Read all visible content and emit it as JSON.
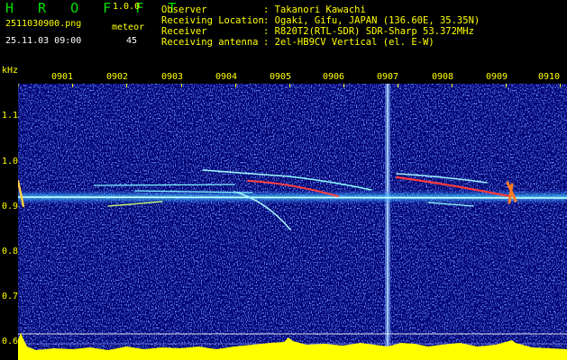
{
  "header": {
    "app_title": "H R O F F T",
    "version": "1.0.0",
    "file_name": "2511030900.png",
    "meteor_label": "meteor",
    "datetime": "25.11.03 09:00",
    "meteor_count": "45"
  },
  "station": [
    {
      "label": "Observer",
      "value": ": Takanori Kawachi"
    },
    {
      "label": "Receiving Location",
      "value": ": Ogaki, Gifu, JAPAN (136.60E, 35.35N)"
    },
    {
      "label": "Receiver",
      "value": ": R820T2(RTL-SDR) SDR-Sharp 53.372MHz"
    },
    {
      "label": "Receiving antenna",
      "value": ": 2el-HB9CV Vertical (el. E-W)"
    }
  ],
  "chart_data": {
    "type": "heatmap",
    "ylabel": "kHz",
    "x_ticks": [
      "0901",
      "0902",
      "0903",
      "0904",
      "0905",
      "0906",
      "0907",
      "0908",
      "0909",
      "0910"
    ],
    "y_ticks": [
      "1.1",
      "1.0",
      "0.9",
      "0.8",
      "0.7",
      "0.6"
    ],
    "colors": {
      "axis_text": "#ffff00",
      "background": "#00006e",
      "noise": "#1f3fff",
      "signal": "#ff2020",
      "trace": "#d8ffff",
      "level": "#ffff00"
    }
  }
}
